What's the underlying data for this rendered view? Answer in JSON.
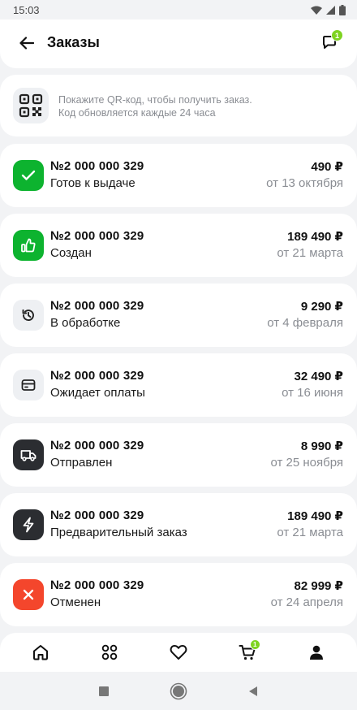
{
  "status_bar": {
    "time": "15:03",
    "icons": [
      "wifi-icon",
      "signal-icon",
      "battery-icon"
    ]
  },
  "header": {
    "title": "Заказы",
    "chat_badge": "1"
  },
  "qr_banner": {
    "text_line1": "Покажите QR-код, чтобы получить заказ.",
    "text_line2": "Код обновляется каждые 24 часа"
  },
  "colors": {
    "green": "#0db32f",
    "light": "#eef0f3",
    "dark": "#2b2d31",
    "red": "#f4462c",
    "badge": "#7ed321"
  },
  "orders": [
    {
      "number": "№2 000 000 329",
      "status": "Готов к выдаче",
      "price": "490 ₽",
      "date": "от 13 октября",
      "icon": "check-icon"
    },
    {
      "number": "№2 000 000 329",
      "status": "Создан",
      "price": "189 490 ₽",
      "date": "от 21 марта",
      "icon": "thumbs-up-icon"
    },
    {
      "number": "№2 000 000 329",
      "status": "В обработке",
      "price": "9 290 ₽",
      "date": "от 4 февраля",
      "icon": "history-icon"
    },
    {
      "number": "№2 000 000 329",
      "status": "Ожидает оплаты",
      "price": "32 490 ₽",
      "date": "от 16 июня",
      "icon": "card-icon"
    },
    {
      "number": "№2 000 000 329",
      "status": "Отправлен",
      "price": "8 990 ₽",
      "date": "от 25 ноября",
      "icon": "truck-icon"
    },
    {
      "number": "№2 000 000 329",
      "status": "Предварительный заказ",
      "price": "189 490 ₽",
      "date": "от 21 марта",
      "icon": "lightning-icon"
    },
    {
      "number": "№2 000 000 329",
      "status": "Отменен",
      "price": "82 999 ₽",
      "date": "от 24 апреля",
      "icon": "cross-icon"
    }
  ],
  "bottom_nav": {
    "items": [
      "home-icon",
      "catalog-icon",
      "favorites-icon",
      "cart-icon",
      "profile-icon"
    ],
    "cart_badge": "1"
  }
}
